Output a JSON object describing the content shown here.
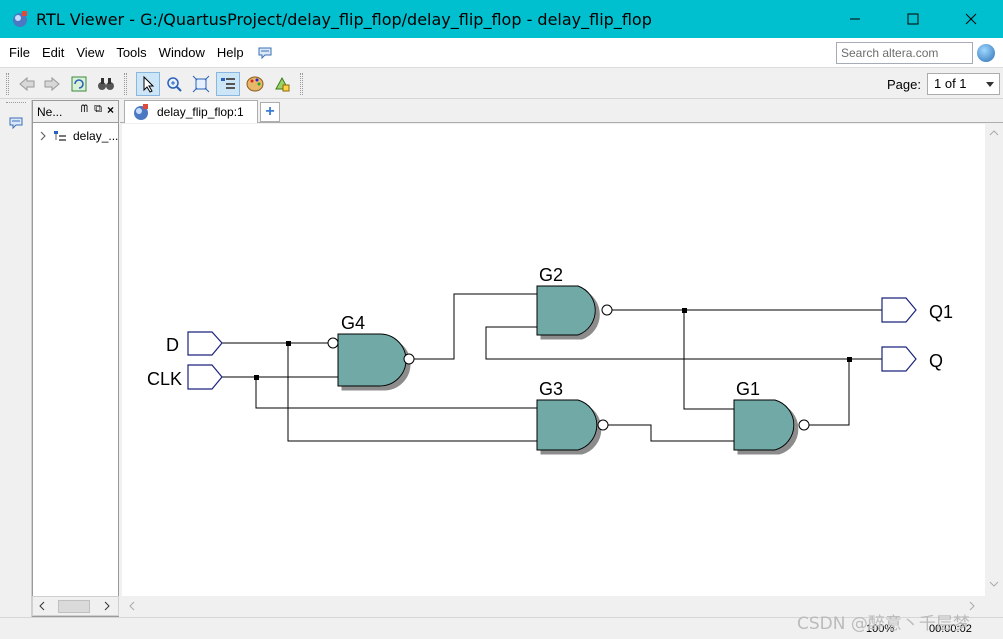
{
  "window": {
    "title": "RTL Viewer - G:/QuartusProject/delay_flip_flop/delay_flip_flop - delay_flip_flop",
    "minimize": "—",
    "maximize": "☐",
    "close": "✕"
  },
  "menu": {
    "items": [
      {
        "label": "File"
      },
      {
        "label": "Edit"
      },
      {
        "label": "View"
      },
      {
        "label": "Tools"
      },
      {
        "label": "Window"
      },
      {
        "label": "Help"
      }
    ],
    "search_placeholder": "Search altera.com"
  },
  "toolbar": {
    "page_label": "Page:",
    "page_value": "1 of 1"
  },
  "navigator": {
    "header": "Ne...",
    "tree_item": "delay_..."
  },
  "tab": {
    "label": "delay_flip_flop:1",
    "add": "+"
  },
  "schematic": {
    "inputs": [
      "D",
      "CLK"
    ],
    "outputs": [
      "Q1",
      "Q"
    ],
    "gates": [
      "G1",
      "G2",
      "G3",
      "G4"
    ]
  },
  "status": {
    "zoom": "100%",
    "time": "00:00:02"
  },
  "watermark": "CSDN @醉意丶千层梦",
  "colors": {
    "titlebar": "#00bfcf",
    "gate_fill": "#6fa9a6",
    "port_stroke": "#1a237e"
  }
}
